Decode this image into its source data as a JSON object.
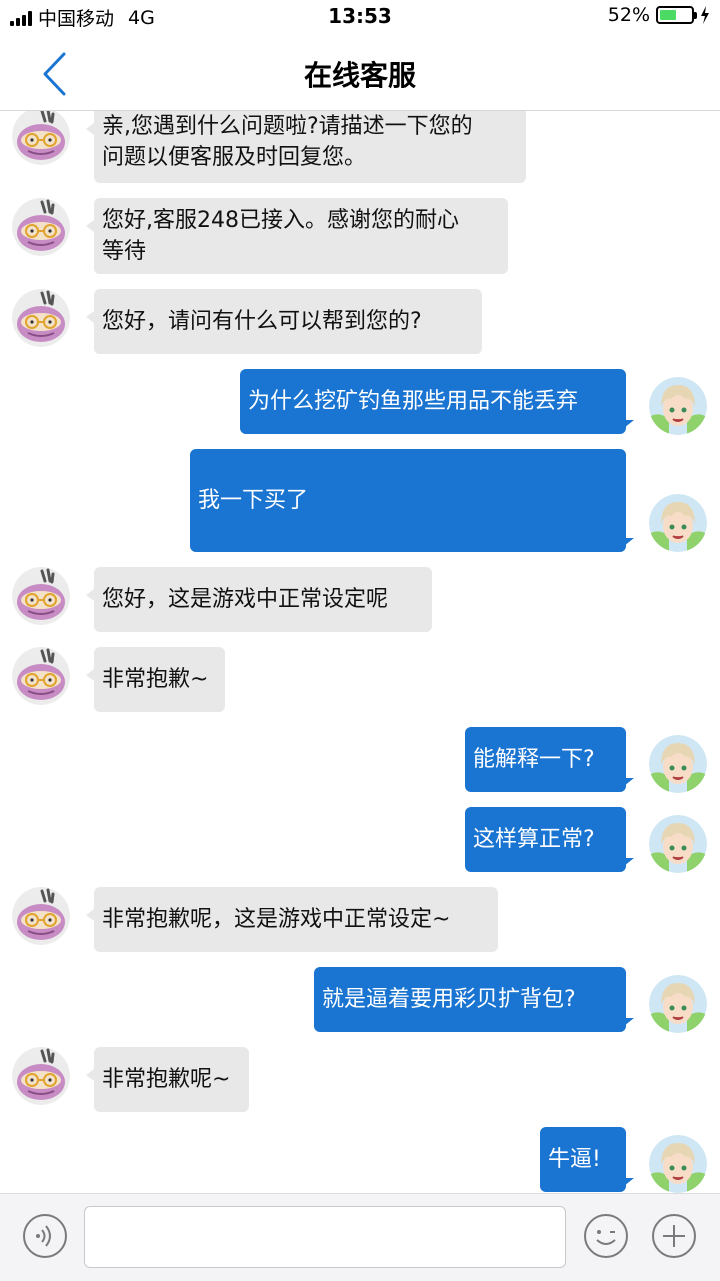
{
  "status_bar": {
    "carrier": "中国移动",
    "network": "4G",
    "time": "13:53",
    "battery": "52%",
    "battery_level": 0.52,
    "battery_color": "#4cd964"
  },
  "nav": {
    "title": "在线客服",
    "back_icon": "chevron-left-icon"
  },
  "colors": {
    "accent": "#1a74d2",
    "left_bubble": "#e8e8e8"
  },
  "messages": [
    {
      "side": "left",
      "lines": [
        "亲,您遇到什么问题啦?请描述一下您的",
        "问题以便客服及时回复您。"
      ]
    },
    {
      "side": "left",
      "lines": [
        "您好,客服248已接入。感谢您的耐心",
        "等待"
      ]
    },
    {
      "side": "left",
      "lines": [
        "您好，请问有什么可以帮到您的?"
      ]
    },
    {
      "side": "right",
      "lines": [
        "为什么挖矿钓鱼那些用品不能丢弃"
      ]
    },
    {
      "side": "right",
      "lines": [
        "我一下买了"
      ]
    },
    {
      "side": "left",
      "lines": [
        "您好，这是游戏中正常设定呢"
      ]
    },
    {
      "side": "left",
      "lines": [
        "非常抱歉~"
      ]
    },
    {
      "side": "right",
      "lines": [
        "能解释一下?"
      ]
    },
    {
      "side": "right",
      "lines": [
        "这样算正常?"
      ]
    },
    {
      "side": "left",
      "lines": [
        "非常抱歉呢，这是游戏中正常设定~"
      ]
    },
    {
      "side": "right",
      "lines": [
        "就是逼着要用彩贝扩背包?"
      ]
    },
    {
      "side": "left",
      "lines": [
        "非常抱歉呢~"
      ]
    },
    {
      "side": "right",
      "lines": [
        "牛逼!"
      ]
    }
  ],
  "input_bar": {
    "voice_icon": "voice-icon",
    "input_value": "",
    "emoji_icon": "emoji-icon",
    "plus_icon": "plus-icon"
  }
}
